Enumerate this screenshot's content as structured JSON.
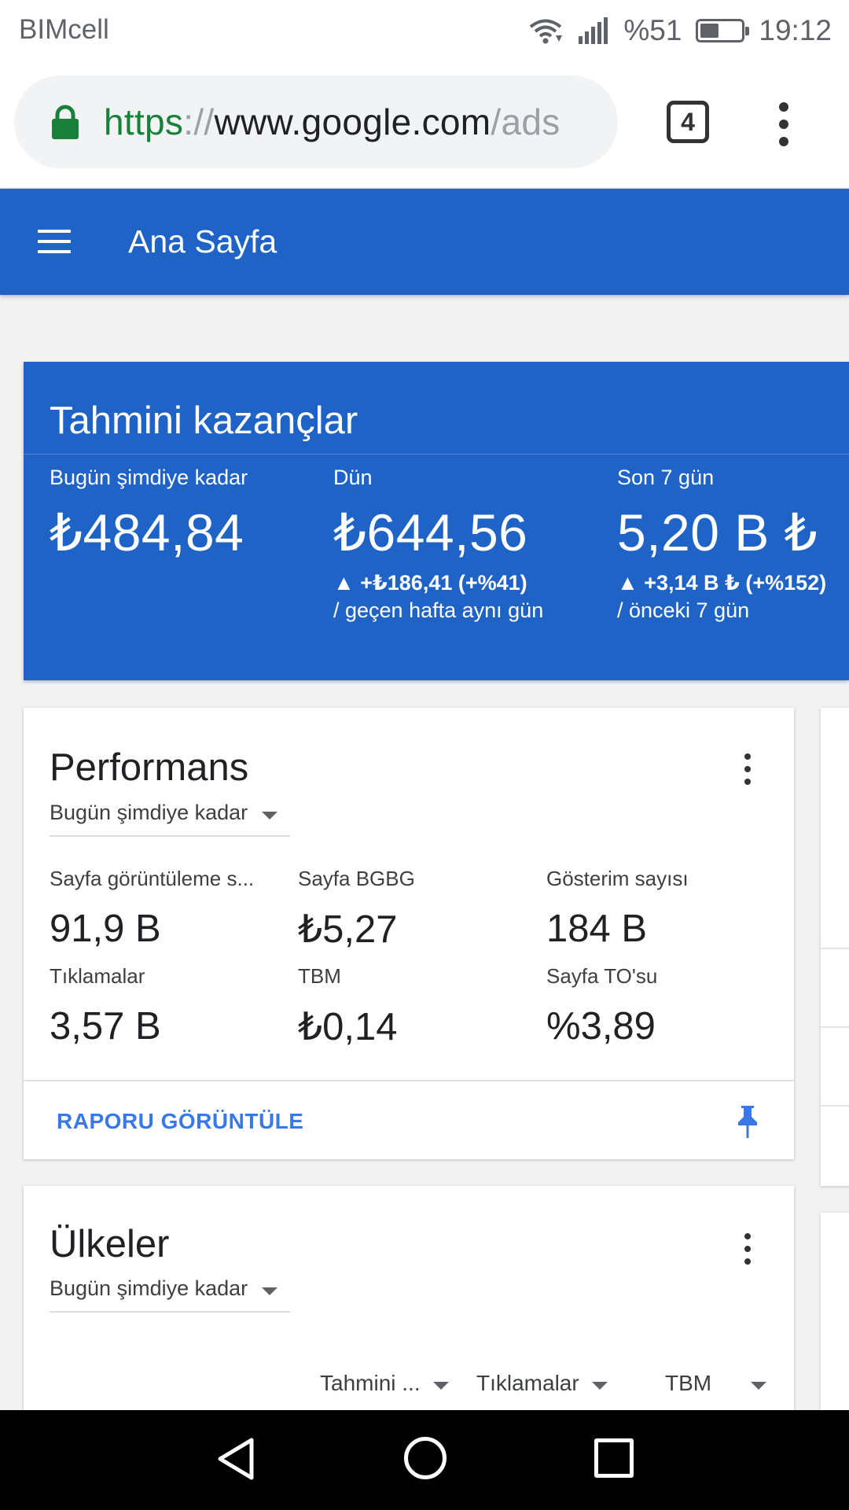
{
  "status_bar": {
    "carrier": "BIMcell",
    "battery_text": "%51",
    "battery_level": 0.51,
    "time": "19:12",
    "icons": [
      "wifi-icon",
      "signal-icon",
      "battery-icon"
    ]
  },
  "browser": {
    "url_scheme": "https",
    "url_separator": "://",
    "url_host": "www.google.com",
    "url_path": "/ads",
    "tab_count": "4",
    "icons": [
      "lock-icon",
      "tabs-icon",
      "more-vert-icon"
    ],
    "colors": {
      "secure": "#188038"
    }
  },
  "app_bar": {
    "title": "Ana Sayfa",
    "icons": [
      "menu-icon"
    ],
    "color": "#1f63c6"
  },
  "earnings": {
    "title": "Tahmini kazançlar",
    "columns": [
      {
        "label": "Bugün şimdiye kadar",
        "value": "₺484,84",
        "change": "",
        "comparison": ""
      },
      {
        "label": "Dün",
        "value": "₺644,56",
        "change": "▲ +₺186,41 (+%41)",
        "comparison": "/ geçen hafta aynı gün"
      },
      {
        "label": "Son 7 gün",
        "value": "5,20 B ₺",
        "change": "▲ +3,14 B ₺ (+%152)",
        "comparison": "/ önceki 7 gün"
      }
    ]
  },
  "performance": {
    "title": "Performans",
    "range": "Bugün şimdiye kadar",
    "metrics": [
      {
        "label": "Sayfa görüntüleme s...",
        "value": "91,9 B"
      },
      {
        "label": "Sayfa BGBG",
        "value": "₺5,27"
      },
      {
        "label": "Gösterim sayısı",
        "value": "184 B"
      },
      {
        "label": "Tıklamalar",
        "value": "3,57 B"
      },
      {
        "label": "TBM",
        "value": "₺0,14"
      },
      {
        "label": "Sayfa TO'su",
        "value": "%3,89"
      }
    ],
    "report_link": "RAPORU GÖRÜNTÜLE",
    "icons": [
      "more-vert-icon",
      "chevron-down-icon",
      "pin-icon"
    ],
    "link_color": "#3b78e7"
  },
  "countries": {
    "title": "Ülkeler",
    "range": "Bugün şimdiye kadar",
    "columns": [
      "Tahmini ...",
      "Tıklamalar",
      "TBM"
    ],
    "icons": [
      "more-vert-icon",
      "chevron-down-icon"
    ]
  },
  "nav_bar": {
    "icons": [
      "back-icon",
      "home-icon",
      "recents-icon"
    ]
  }
}
